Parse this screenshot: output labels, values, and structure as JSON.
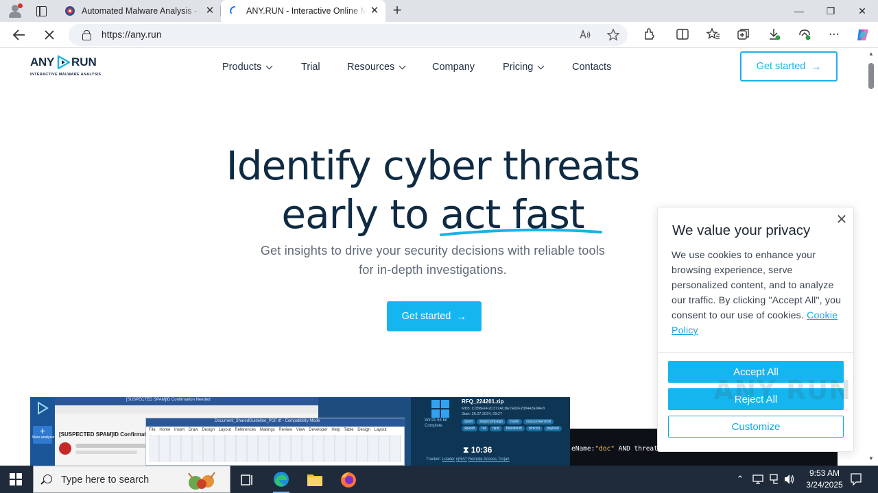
{
  "browser": {
    "tabs": [
      {
        "title": "Automated Malware Analysis - Jo",
        "active": false
      },
      {
        "title": "ANY.RUN - Interactive Online Ma",
        "active": true
      }
    ],
    "url": "https://any.run",
    "new_tab_symbol": "+",
    "window_controls": {
      "minimize": "—",
      "restore": "❐",
      "close": "✕"
    }
  },
  "site": {
    "logo": {
      "word_left": "ANY",
      "word_right": "RUN",
      "tagline": "INTERACTIVE MALWARE ANALYSIS"
    },
    "nav": [
      {
        "label": "Products",
        "dropdown": true
      },
      {
        "label": "Trial",
        "dropdown": false
      },
      {
        "label": "Resources",
        "dropdown": true
      },
      {
        "label": "Company",
        "dropdown": false
      },
      {
        "label": "Pricing",
        "dropdown": true
      },
      {
        "label": "Contacts",
        "dropdown": false
      }
    ],
    "header_cta": "Get started",
    "hero": {
      "line1": "Identify cyber threats",
      "line2": "early to act fast",
      "subtitle_line1": "Get insights to drive your security decisions with reliable tools",
      "subtitle_line2": "for in-depth investigations.",
      "cta": "Get started"
    },
    "preview": {
      "mail_title": "[SUSPECTED SPAM]ID Confirmation Needed",
      "subject": "[SUSPECTED SPAM]ID Confirmation r",
      "doc_title": "Document_SharedGuideline_PDF.rtf - Compatibility Mode",
      "doc_tabs": "File Home Insert Draw Design Layout References Mailings Review View Developer Help Table Design Layout",
      "new_analysis": "New analysis",
      "os_label": "Win11 64 bit",
      "os_status": "Complete",
      "file_name": "RFQ_224201.zip",
      "md5": "MD5: CD58EFF2C372AC8E7E60F208442E9AF8",
      "start": "Start: 26.07.2024, 09:27",
      "tags": [
        "spam",
        "stegocampaign",
        "loader",
        "susp-powershell",
        "xpandr",
        "rat",
        "njrat",
        "bladabindi",
        "remcos",
        "payload"
      ],
      "timer": "10:36",
      "tracker_label": "Tracker:",
      "tracker_links": [
        "Loader",
        "njRAT",
        "Remote Access Trojan"
      ],
      "query_prefix": "eName:",
      "query_value1": "\"doc\"",
      "query_mid": " AND threatName:",
      "query_value2": "\"n"
    },
    "cookie": {
      "title": "We value your privacy",
      "body": "We use cookies to enhance your browsing experience, serve personalized content, and to analyze our traffic. By clicking \"Accept All\", you consent to our use of cookies. ",
      "policy_link": "Cookie Policy",
      "accept": "Accept All",
      "reject": "Reject All",
      "customize": "Customize"
    },
    "watermark": "ANY RUN"
  },
  "taskbar": {
    "search_placeholder": "Type here to search",
    "time": "9:53 AM",
    "date": "3/24/2025"
  },
  "colors": {
    "accent": "#15b6f0",
    "navy": "#0f2b44",
    "taskbar": "#1f2b3a"
  }
}
